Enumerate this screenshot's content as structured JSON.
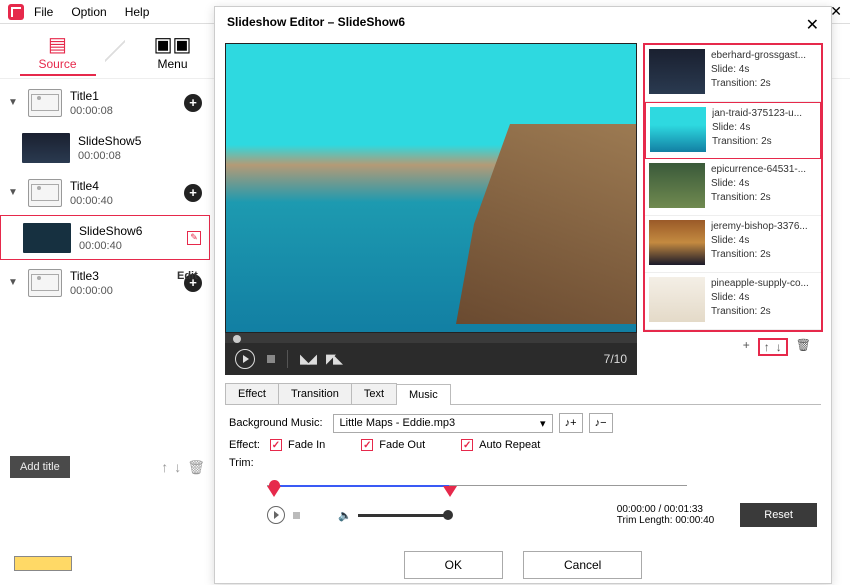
{
  "menubar": {
    "file": "File",
    "option": "Option",
    "help": "Help"
  },
  "tabs": {
    "source": "Source",
    "menu": "Menu"
  },
  "sidebar": {
    "titles": [
      {
        "name": "Title1",
        "time": "00:00:08"
      },
      {
        "name": "Title4",
        "time": "00:00:40"
      },
      {
        "name": "Title3",
        "time": "00:00:00"
      }
    ],
    "slides": [
      {
        "name": "SlideShow5",
        "time": "00:00:08"
      },
      {
        "name": "SlideShow6",
        "time": "00:00:40"
      }
    ],
    "edit_label": "Edit",
    "add_title": "Add title"
  },
  "dialog": {
    "title": "Slideshow Editor   –   SlideShow6",
    "counter": "7/10",
    "thumbs": [
      {
        "name": "eberhard-grossgast...",
        "slide": "Slide: 4s",
        "trans": "Transition: 2s"
      },
      {
        "name": "jan-traid-375123-u...",
        "slide": "Slide: 4s",
        "trans": "Transition: 2s"
      },
      {
        "name": "epicurrence-64531-...",
        "slide": "Slide: 4s",
        "trans": "Transition: 2s"
      },
      {
        "name": "jeremy-bishop-3376...",
        "slide": "Slide: 4s",
        "trans": "Transition: 2s"
      },
      {
        "name": "pineapple-supply-co...",
        "slide": "Slide: 4s",
        "trans": "Transition: 2s"
      }
    ],
    "editor_tabs": {
      "effect": "Effect",
      "transition": "Transition",
      "text": "Text",
      "music": "Music"
    },
    "music": {
      "bg_label": "Background Music:",
      "bg_value": "Little Maps - Eddie.mp3",
      "effect_label": "Effect:",
      "fade_in": "Fade In",
      "fade_out": "Fade Out",
      "auto_repeat": "Auto Repeat",
      "trim_label": "Trim:",
      "time": "00:00:00 / 00:01:33",
      "trim_len": "Trim Length: 00:00:40",
      "reset": "Reset"
    },
    "ok": "OK",
    "cancel": "Cancel"
  }
}
